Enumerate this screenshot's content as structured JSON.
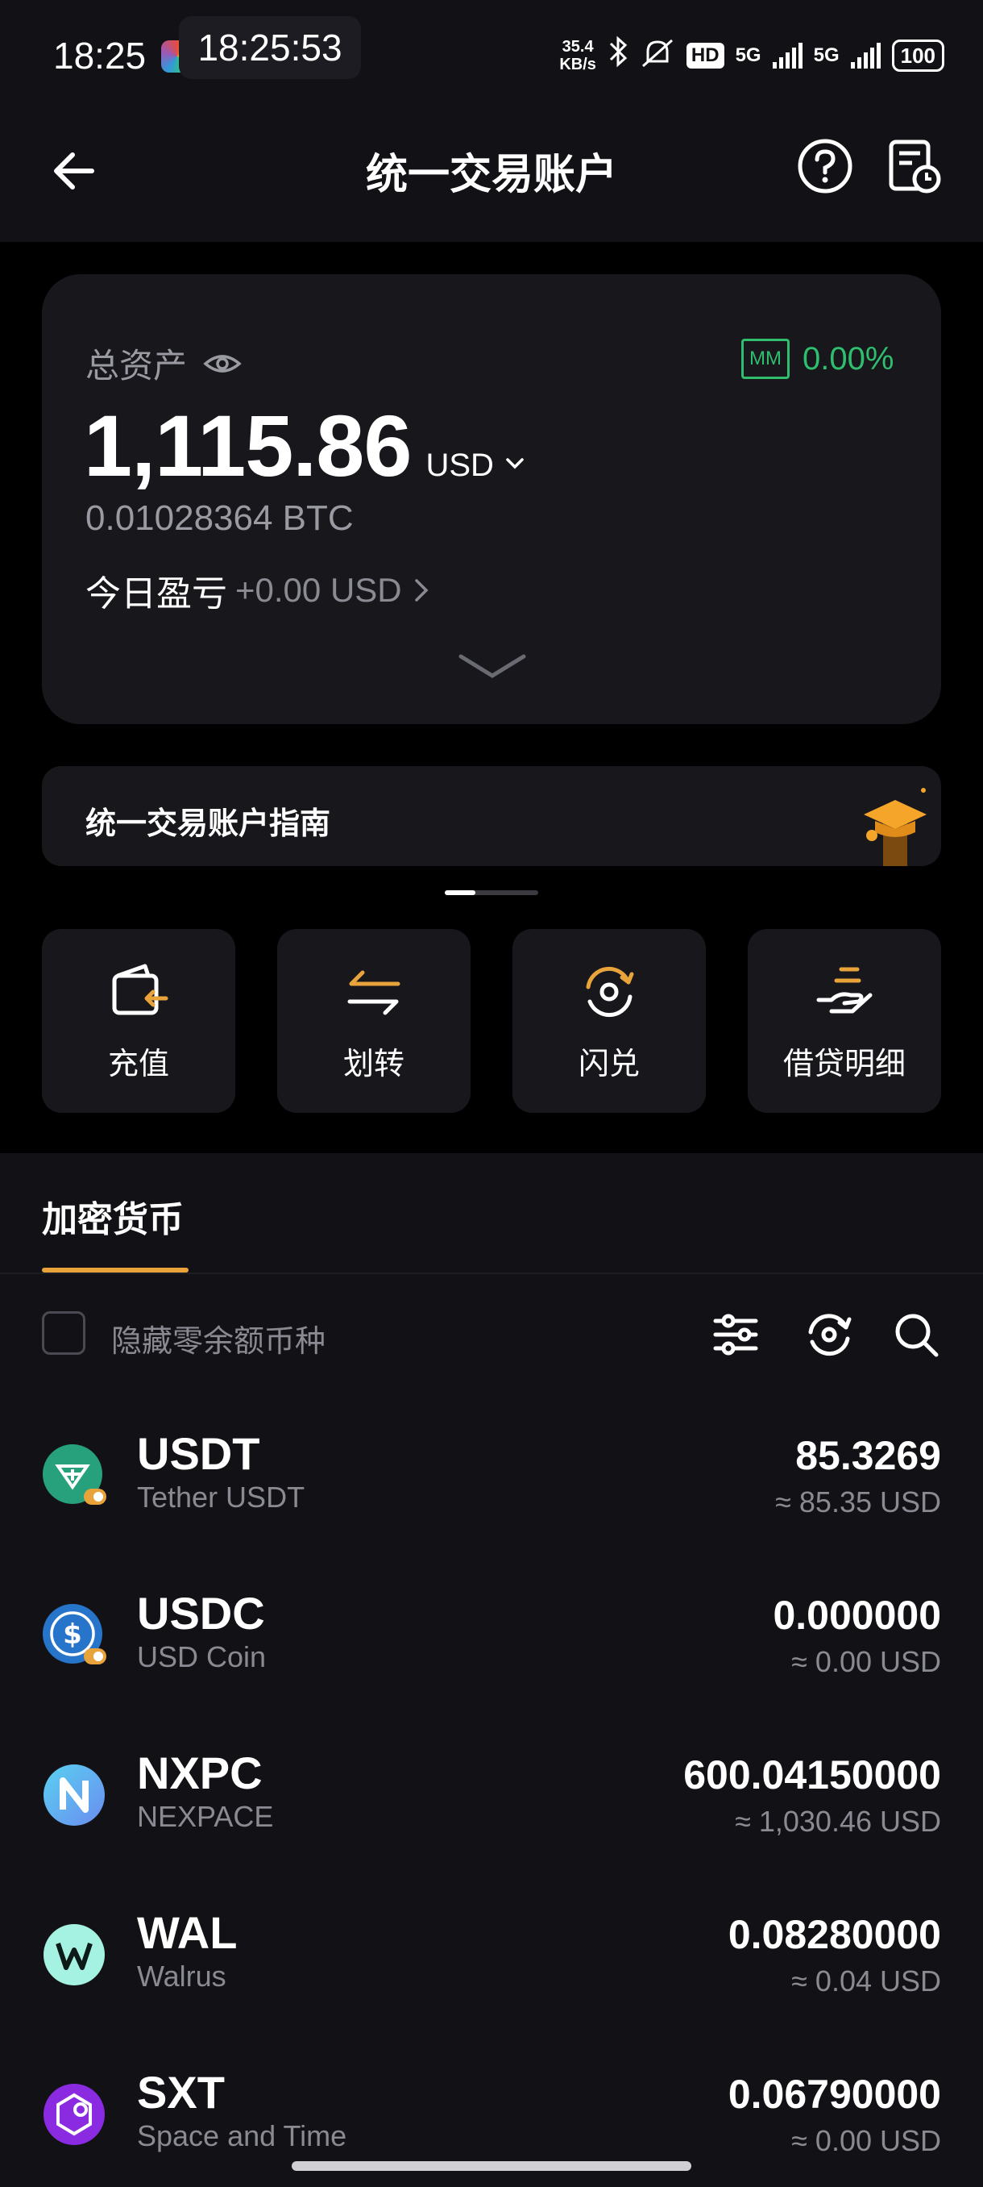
{
  "status_bar": {
    "time": "18:25",
    "overlay_time": "18:25:53",
    "net_speed_top": "35.4",
    "net_speed_bottom": "KB/s",
    "hd_label": "HD",
    "signal1": "5G",
    "signal2": "5G",
    "battery": "100"
  },
  "header": {
    "title": "统一交易账户"
  },
  "asset_card": {
    "label": "总资产",
    "mm_badge": "MM",
    "mm_percent": "0.00%",
    "total_amount": "1,115.86",
    "unit": "USD",
    "btc_amount": "0.01028364 BTC",
    "pnl_label": "今日盈亏",
    "pnl_value": "+0.00 USD"
  },
  "guide_banner": {
    "text": "统一交易账户指南"
  },
  "actions": [
    {
      "label": "充值",
      "icon": "deposit-icon"
    },
    {
      "label": "划转",
      "icon": "transfer-icon"
    },
    {
      "label": "闪兑",
      "icon": "convert-icon"
    },
    {
      "label": "借贷明细",
      "icon": "loan-icon"
    }
  ],
  "tabs": {
    "active": "加密货币"
  },
  "filter": {
    "hide_zero_label": "隐藏零余额币种"
  },
  "coins": [
    {
      "symbol": "USDT",
      "name": "Tether USDT",
      "amount": "85.3269",
      "usd": "≈ 85.35 USD",
      "color": "#26a17b"
    },
    {
      "symbol": "USDC",
      "name": "USD Coin",
      "amount": "0.000000",
      "usd": "≈ 0.00 USD",
      "color": "#2775ca"
    },
    {
      "symbol": "NXPC",
      "name": "NEXPACE",
      "amount": "600.04150000",
      "usd": "≈ 1,030.46 USD",
      "color": "#3fb8e8"
    },
    {
      "symbol": "WAL",
      "name": "Walrus",
      "amount": "0.08280000",
      "usd": "≈ 0.04 USD",
      "color": "#a6f2e2"
    },
    {
      "symbol": "SXT",
      "name": "Space and Time",
      "amount": "0.06790000",
      "usd": "≈ 0.00 USD",
      "color": "#8a2be2"
    }
  ],
  "colors": {
    "accent": "#e8a33b",
    "positive": "#2fbd6e",
    "card_bg": "#17171c",
    "sheet_bg": "#121216"
  }
}
